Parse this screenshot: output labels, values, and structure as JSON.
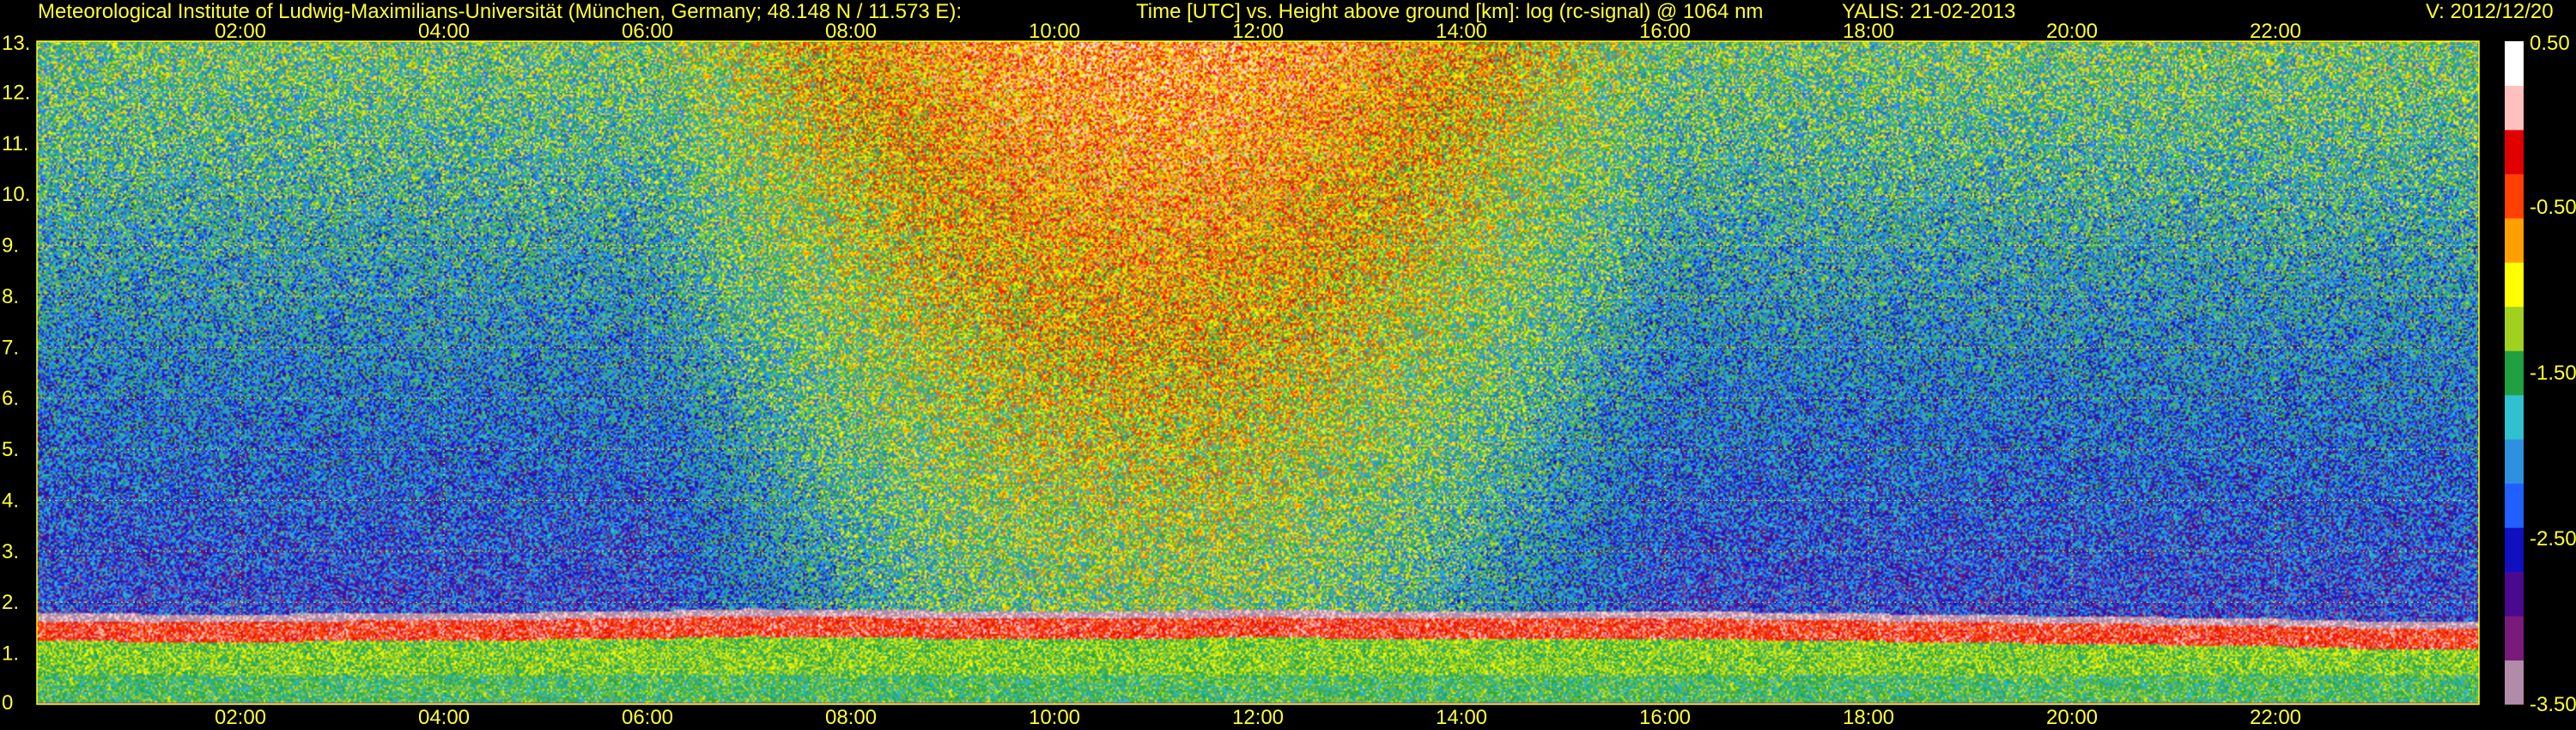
{
  "header": {
    "institute": "Meteorological Institute of Ludwig-Maximilians-Universität (München, Germany; 48.148 N / 11.573 E):",
    "description": "Time [UTC] vs. Height above ground [km]: log (rc-signal) @ 1064 nm",
    "instrument_date": "YALIS: 21-02-2013",
    "version": "V: 2012/12/20"
  },
  "chart_data": {
    "type": "heatmap",
    "title": "Time [UTC] vs. Height above ground [km]: log (rc-signal) @ 1064 nm",
    "xlabel": "Time [UTC]",
    "ylabel": "Height above ground [km]",
    "x_tick_labels": [
      "02:00",
      "04:00",
      "06:00",
      "08:00",
      "10:00",
      "12:00",
      "14:00",
      "16:00",
      "18:00",
      "20:00",
      "22:00"
    ],
    "x_ticks_hours": [
      2,
      4,
      6,
      8,
      10,
      12,
      14,
      16,
      18,
      20,
      22
    ],
    "xlim_hours": [
      0,
      24
    ],
    "y_tick_labels": [
      "0",
      "1.",
      "2.",
      "3.",
      "4.",
      "5.",
      "6.",
      "7.",
      "8.",
      "9.",
      "10.",
      "11.",
      "12.",
      "13."
    ],
    "y_ticks_km": [
      0,
      1,
      2,
      3,
      4,
      5,
      6,
      7,
      8,
      9,
      10,
      11,
      12,
      13
    ],
    "ylim_km": [
      0,
      13
    ],
    "grid": true,
    "colorbar": {
      "range": [
        -3.5,
        0.5
      ],
      "tick_labels": [
        "0.50",
        "-0.50",
        "-1.50",
        "-2.50",
        "-3.50"
      ],
      "tick_values": [
        0.5,
        -0.5,
        -1.5,
        -2.5,
        -3.5
      ]
    },
    "boundary_layer_top_km": [
      [
        0.0,
        1.75
      ],
      [
        2.0,
        1.74
      ],
      [
        4.0,
        1.76
      ],
      [
        6.0,
        1.8
      ],
      [
        7.0,
        1.85
      ],
      [
        8.0,
        1.82
      ],
      [
        10.0,
        1.8
      ],
      [
        12.0,
        1.82
      ],
      [
        14.0,
        1.8
      ],
      [
        16.0,
        1.8
      ],
      [
        18.0,
        1.75
      ],
      [
        20.0,
        1.7
      ],
      [
        22.0,
        1.65
      ],
      [
        23.0,
        1.6
      ],
      [
        24.0,
        1.6
      ]
    ],
    "colors": {
      "grid": "#ffff00",
      "text": "#ffff33",
      "colormap": [
        "#b08ca8",
        "#7a1a7a",
        "#4a0a90",
        "#1010c0",
        "#2060ff",
        "#3090e0",
        "#30c0d0",
        "#20a040",
        "#a0d020",
        "#ffff00",
        "#ffa000",
        "#ff4000",
        "#e00000",
        "#ffc0c0",
        "#ffffff"
      ]
    }
  }
}
